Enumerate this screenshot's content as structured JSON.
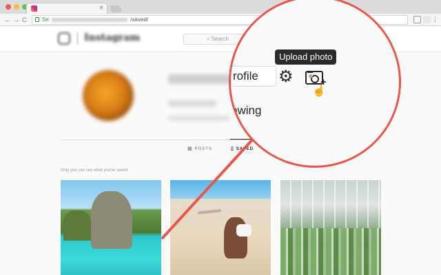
{
  "browser": {
    "tab_close": "×",
    "url_secure": "Se",
    "url_tail": "/saved/",
    "nav": {
      "back": "←",
      "forward": "→",
      "reload": "C"
    },
    "menu_glyph": "⋮"
  },
  "instagram": {
    "search_placeholder": "Search",
    "search_icon": "⌕"
  },
  "profile": {
    "tabs": [
      {
        "icon": "▦",
        "label": "POSTS",
        "active": false
      },
      {
        "icon": "▯",
        "label": "SAVED",
        "active": true
      }
    ],
    "private_note": "Only you can see what you've saved"
  },
  "callout": {
    "edit_profile_partial": "rofile",
    "gear_glyph": "⚙",
    "tooltip": "Upload photo",
    "following_partial": "owing",
    "cursor_glyph": "☝",
    "plus_glyph": "+"
  },
  "colors": {
    "annotation": "#e8574b",
    "tooltip_bg": "#2b2b2b"
  },
  "icons": [
    "camera-plus-icon",
    "gear-icon",
    "search-icon",
    "lock-icon",
    "instagram-logo-icon",
    "hand-cursor-icon"
  ]
}
